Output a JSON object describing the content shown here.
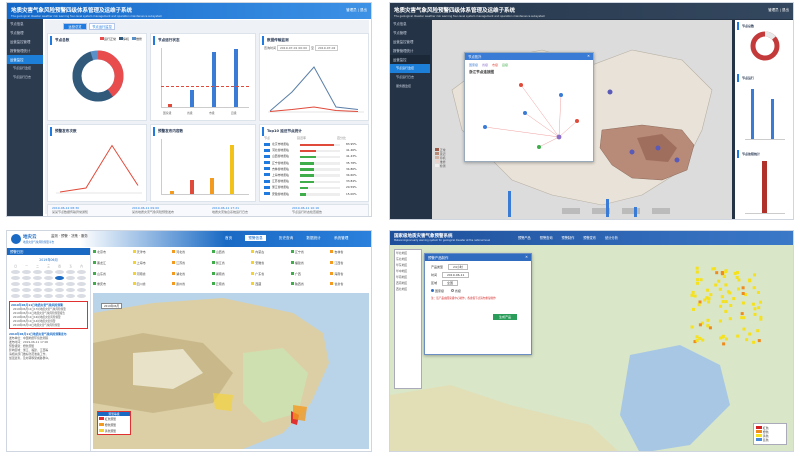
{
  "p1": {
    "title": "地质灾害气象风险预警四级体系管理及运维子系统",
    "subtitle": "The geological disaster weather risk warning four-level system management and operation maintenance subsystem",
    "user": "管理员  | 退出",
    "menu": [
      "节点信息",
      "节点管理",
      "运营监控管理",
      "报警管理统计"
    ],
    "menu_section": "运营监控",
    "submenu": [
      "节点运行监控",
      "节点运行日志"
    ],
    "tabs": [
      "运营总览",
      "节点运行监控"
    ],
    "donut_title": "节点总数",
    "donut_legend": [
      "运行正常",
      "停机",
      "维修",
      "检测"
    ],
    "donut_values": [
      {
        "color": "#e84c4c",
        "value": 40
      },
      {
        "color": "#31597a",
        "value": 55
      },
      {
        "color": "#5a90c8",
        "value": 5
      }
    ],
    "bar_title": "节点运行状态",
    "bar_labels": [
      "国家级",
      "省级",
      "市级",
      "县级"
    ],
    "bar_values": [
      5,
      30,
      95,
      100
    ],
    "line_title": "数据传输监测",
    "line_filter": [
      "查询时间",
      "2019-07-01 00:00",
      "至",
      "2019-07-02"
    ],
    "line_legend": [
      "成功",
      "失败"
    ],
    "line_success": [
      2,
      40,
      90,
      10,
      5
    ],
    "line_fail": [
      1,
      5,
      10,
      3,
      1
    ],
    "cpu_title": "预警发布次数",
    "cpu_values": [
      2,
      10,
      95,
      15
    ],
    "mem_title": "预警发布内容数",
    "mem_values": [
      5,
      25,
      30,
      90
    ],
    "top_title": "Top10 延迟节点统计",
    "top_headers": [
      "节点",
      "延迟率",
      "百分比"
    ],
    "top_rows": [
      {
        "name": "北京市地质站",
        "pct": "83.95%",
        "w": 0.84,
        "color": "#e04a3a"
      },
      {
        "name": "河北省地质站",
        "pct": "41.46%",
        "w": 0.41,
        "color": "#e04a3a"
      },
      {
        "name": "山西省地质站",
        "pct": "41.43%",
        "w": 0.41,
        "color": "#3fae4a"
      },
      {
        "name": "辽宁省地质站",
        "pct": "35.78%",
        "w": 0.36,
        "color": "#3fae4a"
      },
      {
        "name": "吉林省地质站",
        "pct": "34.86%",
        "w": 0.35,
        "color": "#3fae4a"
      },
      {
        "name": "上海市地质站",
        "pct": "34.60%",
        "w": 0.35,
        "color": "#3fae4a"
      },
      {
        "name": "江苏省地质站",
        "pct": "33.84%",
        "w": 0.34,
        "color": "#3fae4a"
      },
      {
        "name": "浙江省地质站",
        "pct": "20.59%",
        "w": 0.21,
        "color": "#3fae4a"
      },
      {
        "name": "安徽省地质站",
        "pct": "15.00%",
        "w": 0.15,
        "color": "#3fae4a"
      }
    ],
    "timeline": [
      "2019-06-12 08:30",
      "2019-06-11 09:00",
      "2019-06-11 17:21",
      "2019-06-11 10:16"
    ],
    "timeline_text": [
      "某某节点数据传输异常通知",
      "某省地质灾害气象风险预警发布",
      "地质灾害信息系统运行日志",
      "节点运行状态检查报告"
    ]
  },
  "p2": {
    "title": "地质灾害气象风险预警四级体系管理及运维子系统",
    "subtitle": "The geological disaster weather risk warning four-level system management and operation maintenance subsystem",
    "user": "管理员 | 退出",
    "menu": [
      "节点信息",
      "节点管理",
      "运营监控管理",
      "报警管理统计"
    ],
    "menu_section": "运营监控",
    "submenu": [
      "节点运行监控",
      "节点运行日志",
      "服务器监控"
    ],
    "popup_title": "节点拓扑",
    "popup_name": "浙江节点连接图",
    "popup_legend": [
      "国家级",
      "省级",
      "市级",
      "县级"
    ],
    "right_titles": [
      "节点总数",
      "节点运行",
      "节点故障统计"
    ],
    "map_legend": [
      "正常",
      "延迟",
      "停机",
      "维修",
      "检测"
    ],
    "bottom_labels": [
      "国家级",
      "省级",
      "市级",
      "县级",
      "区级",
      "其他"
    ]
  },
  "p3": {
    "logo": "地灾云",
    "logo_sub": "地质灾害气象风险预警平台",
    "slogan": "监测 · 预警 · 决策 · 服务",
    "nav": [
      "首页",
      "预警信息",
      "历史查询",
      "数据统计",
      "系统管理"
    ],
    "side_title": "预警日历",
    "month": "2019年06月",
    "week": [
      "日",
      "一",
      "二",
      "三",
      "四",
      "五",
      "六"
    ],
    "list_title": "2019年06月11日地质灾害气象风险预警",
    "list_items": [
      "2019年06月11日17时地质灾害气象风险预警",
      "2019年06月11日地质灾害气象风险预警报告",
      "2019年06月11日16时地质灾害风险预警",
      "2019年06月11日14时地质灾害预警",
      "2019年06月10日地质灾害气象风险预警"
    ],
    "detail_title": "2019年06月11日地质灾害气象风险预警发布",
    "detail": [
      "发布单位：中国地质环境监测院",
      "发布时间：2019-06-11 17:00",
      "预警级别：橙色预警",
      "影响区域：浙江、福建、江西等",
      "请相关部门做好防范准备工作，",
      "加强巡查，及时转移受威胁群众。"
    ],
    "provinces": [
      "北京市",
      "天津市",
      "河北省",
      "山西省",
      "内蒙古",
      "辽宁省",
      "吉林省",
      "黑龙江",
      "上海市",
      "江苏省",
      "浙江省",
      "安徽省",
      "福建省",
      "江西省",
      "山东省",
      "河南省",
      "湖北省",
      "湖南省",
      "广东省",
      "广西",
      "海南省",
      "重庆市",
      "四川省",
      "贵州省",
      "云南省",
      "西藏",
      "陕西省",
      "甘肃省"
    ],
    "legend_title": "预警等级",
    "legend": [
      "红色预警",
      "橙色预警",
      "黄色预警"
    ],
    "legend_colors": [
      "#e03030",
      "#f39a21",
      "#f2d33a"
    ]
  },
  "p4": {
    "title": "国家级地质灾害气象预警系统",
    "subtitle": "Meteorological early warning system for geological disaster at the national level",
    "nav": [
      "预警产品",
      "预警查询",
      "预警制作",
      "预警发布",
      "统计分析"
    ],
    "dialog_title": "预警产品制作",
    "dialog_rows": [
      "产品类型",
      "时间",
      "区域"
    ],
    "dialog_values": [
      "24小时",
      "2019-06-11",
      "全国"
    ],
    "radio": [
      "国家级",
      "省级"
    ],
    "warn": "注：该产品由国家级中心制作，各省级节点请勿重复制作",
    "btn": "生成产品",
    "tree": [
      "华北地区",
      "东北地区",
      "华东地区",
      "华中地区",
      "华南地区",
      "西南地区",
      "西北地区"
    ],
    "legend": [
      "红色",
      "橙色",
      "黄色",
      "蓝色"
    ],
    "legend_colors": [
      "#d42020",
      "#f08a1c",
      "#f6e21c",
      "#4a8ad6"
    ]
  }
}
